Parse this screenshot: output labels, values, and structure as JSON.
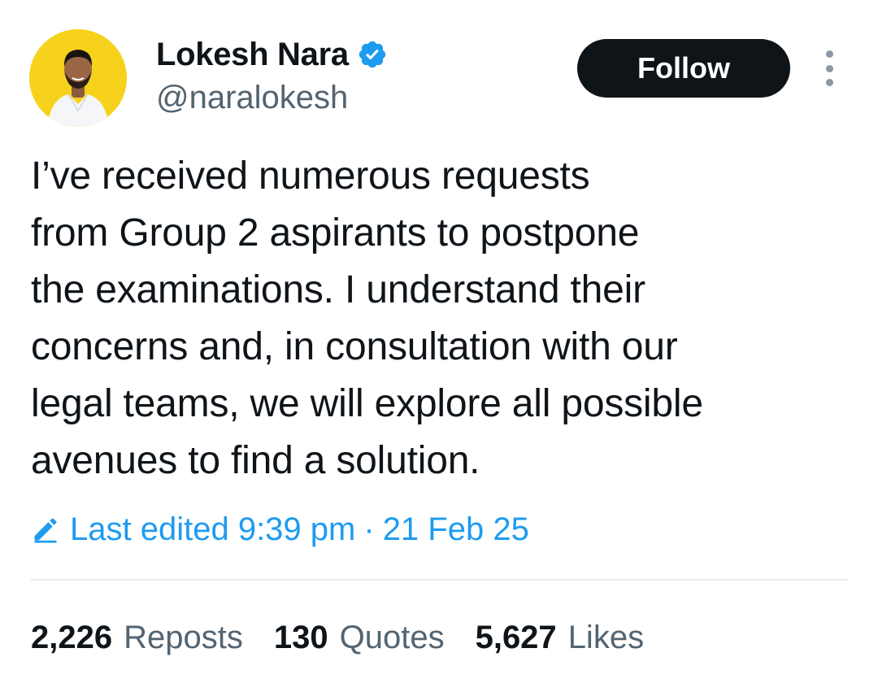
{
  "author": {
    "display_name": "Lokesh Nara",
    "handle": "@naralokesh",
    "verified": true,
    "avatar_bg_color": "#f7d21c"
  },
  "actions": {
    "follow_label": "Follow",
    "more_icon": "more-vertical-icon"
  },
  "tweet": {
    "text": "I’ve received numerous requests\nfrom Group 2 aspirants to postpone\nthe examinations. I understand their\nconcerns and, in consultation with our\nlegal teams, we will explore all possible\navenues to find a solution.",
    "edited_label": "Last edited 9:39 pm",
    "separator": "·",
    "date": "21 Feb 25",
    "edit_icon": "pencil-icon"
  },
  "stats": [
    {
      "count": "2,226",
      "label": "Reposts"
    },
    {
      "count": "130",
      "label": "Quotes"
    },
    {
      "count": "5,627",
      "label": "Likes"
    }
  ],
  "colors": {
    "accent": "#1d9bf0",
    "text_primary": "#0f1419",
    "text_secondary": "#536471",
    "button_bg": "#0f1419"
  }
}
